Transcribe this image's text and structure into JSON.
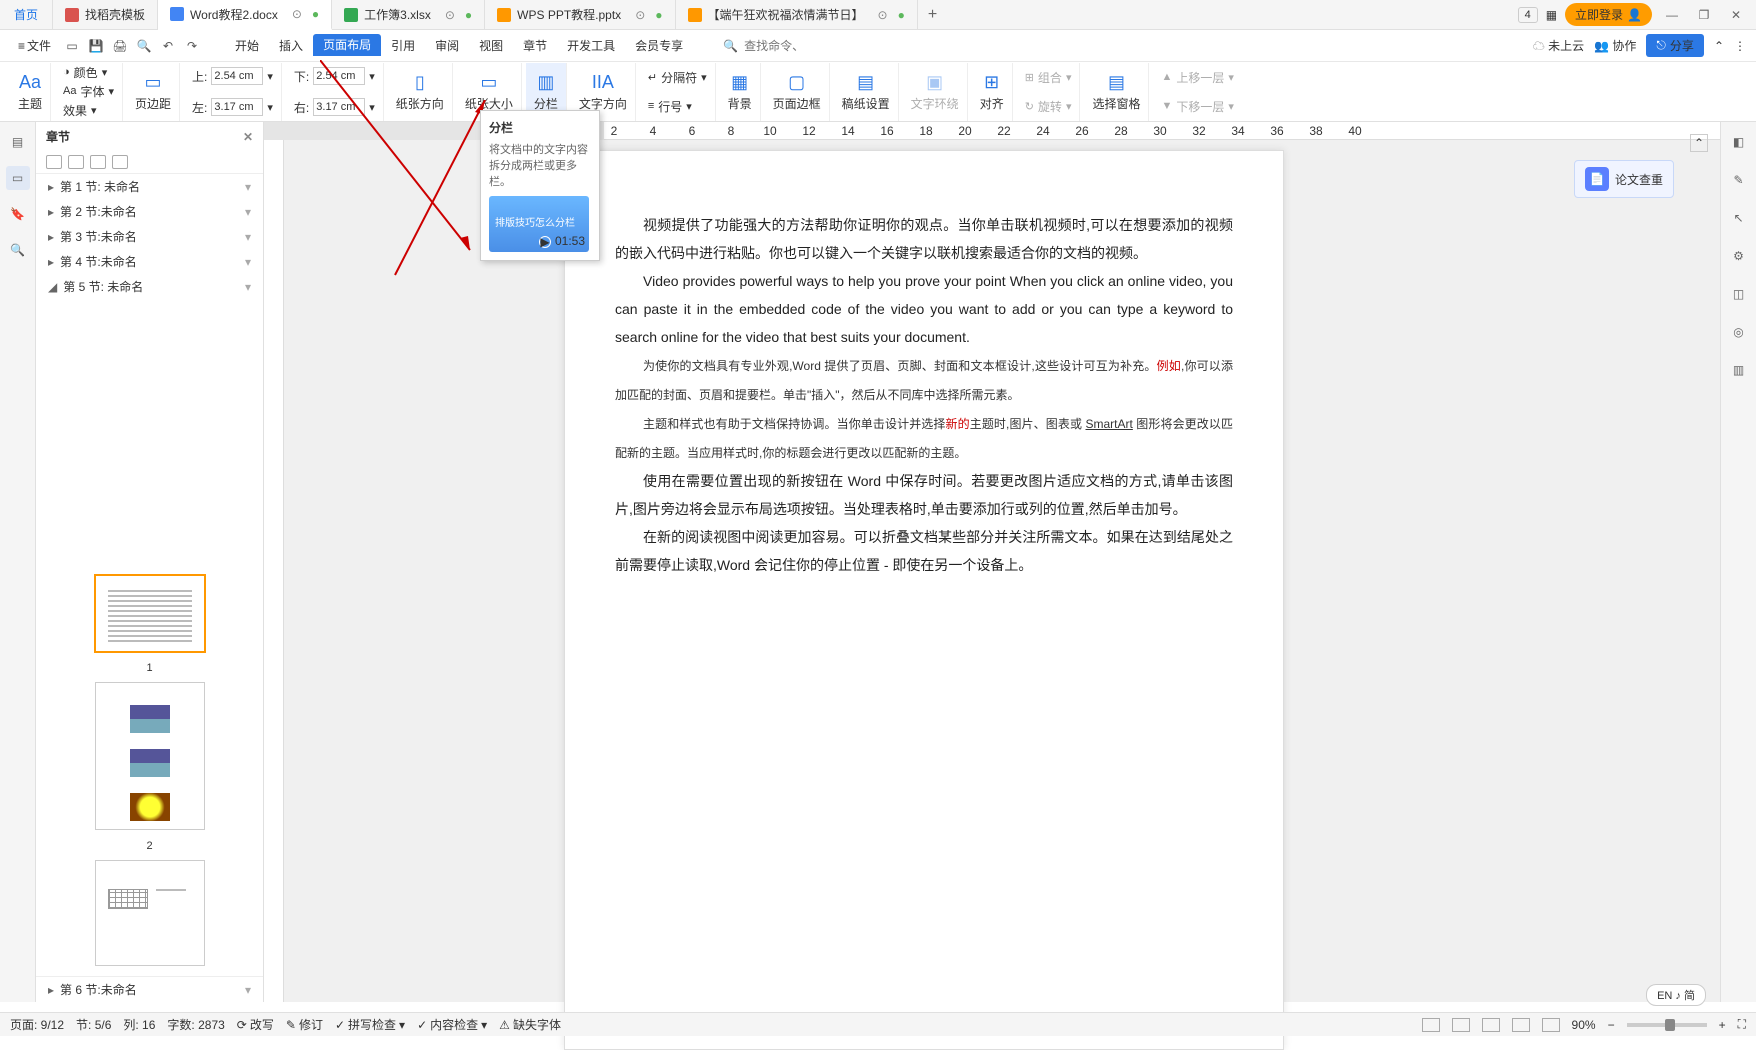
{
  "tabs": {
    "home": "首页",
    "t1": "找稻壳模板",
    "t2": "Word教程2.docx",
    "t3": "工作簿3.xlsx",
    "t4": "WPS PPT教程.pptx",
    "t5": "【端午狂欢祝福浓情满节日】",
    "save_glyph": "●"
  },
  "win": {
    "badge": "4",
    "login": "立即登录",
    "min": "—",
    "restore": "❐",
    "close": "✕"
  },
  "menu": {
    "file": "文件",
    "tabs": [
      "开始",
      "插入",
      "页面布局",
      "引用",
      "审阅",
      "视图",
      "章节",
      "开发工具",
      "会员专享"
    ],
    "active_index": 2,
    "search_icon": "🔍",
    "search_placeholder": "查找命令、搜索模板",
    "cloud": "未上云",
    "coop": "协作",
    "share": "分享"
  },
  "ribbon": {
    "theme": "主题",
    "font": "字体",
    "effect": "效果",
    "color": "颜色",
    "margins": "页边距",
    "top": "上:",
    "top_v": "2.54 cm",
    "bottom": "下:",
    "bottom_v": "2.54 cm",
    "left": "左:",
    "left_v": "3.17 cm",
    "right": "右:",
    "right_v": "3.17 cm",
    "paper_orient": "纸张方向",
    "paper_size": "纸张大小",
    "columns": "分栏",
    "text_dir": "文字方向",
    "breaks": "分隔符",
    "line_no": "行号",
    "background": "背景",
    "page_border": "页面边框",
    "paper_setup": "稿纸设置",
    "text_wrap": "文字环绕",
    "align": "对齐",
    "rotate": "旋转",
    "group": "组合",
    "select_pane": "选择窗格",
    "bring_fwd": "上移一层",
    "send_back": "下移一层"
  },
  "nav": {
    "title": "章节",
    "items": [
      "第 1 节: 未命名",
      "第 2 节:未命名",
      "第 3 节:未命名",
      "第 4 节:未命名",
      "第 5 节: 未命名"
    ],
    "active_index": 4,
    "last": "第 6 节:未命名",
    "thumb_nums": [
      "1",
      "2"
    ]
  },
  "ruler": [
    "2",
    "4",
    "6",
    "8",
    "10",
    "12",
    "14",
    "16",
    "18",
    "20",
    "22",
    "24",
    "26",
    "28",
    "30",
    "32",
    "34",
    "36",
    "38",
    "40"
  ],
  "tooltip": {
    "title": "分栏",
    "desc": "将文档中的文字内容拆分成两栏或更多栏。",
    "vid_title": "排版技巧怎么分栏",
    "vid_time": "01:53"
  },
  "doc": {
    "p1": "视频提供了功能强大的方法帮助你证明你的观点。当你单击联机视频时,可以在想要添加的视频的嵌入代码中进行粘贴。你也可以键入一个关键字以联机搜索最适合你的文档的视频。",
    "p2": "Video provides powerful ways to help you prove your point When you click an online video, you can paste it in the embedded code of the video you want to add or you can type a keyword to search online for the video that best suits your document.",
    "p3a": "为使你的文档具有专业外观,Word 提供了页眉、页脚、封面和文本框设计,这些设计可互为补充。",
    "p3b": "例如",
    "p3c": ",你可以添加匹配的封面、页眉和提要栏。单击\"插入\"，然后从不同库中选择所需元素。",
    "p4a": "主题和样式也有助于文档保持协调。当你单击设计并选择",
    "p4b": "新的",
    "p4c": "主题时,图片、图表或 ",
    "p4d": "SmartArt",
    "p4e": " 图形将会更改以匹配新的主题。当应用样式时,你的标题会进行更改以匹配新的主题。",
    "p5": "使用在需要位置出现的新按钮在 Word 中保存时间。若要更改图片适应文档的方式,请单击该图片,图片旁边将会显示布局选项按钮。当处理表格时,单击要添加行或列的位置,然后单击加号。",
    "p6": "在新的阅读视图中阅读更加容易。可以折叠文档某些部分并关注所需文本。如果在达到结尾处之前需要停止读取,Word 会记住你的停止位置 - 即使在另一个设备上。"
  },
  "check": {
    "label": "论文查重"
  },
  "status": {
    "page": "页面: 9/12",
    "section": "节: 5/6",
    "line": "列: 16",
    "words": "字数: 2873",
    "revise": "改写",
    "edit": "修订",
    "spell": "拼写检查",
    "content": "内容检查",
    "lost": "缺失字体",
    "zoom": "90%",
    "lang": "EN ♪ 简"
  }
}
